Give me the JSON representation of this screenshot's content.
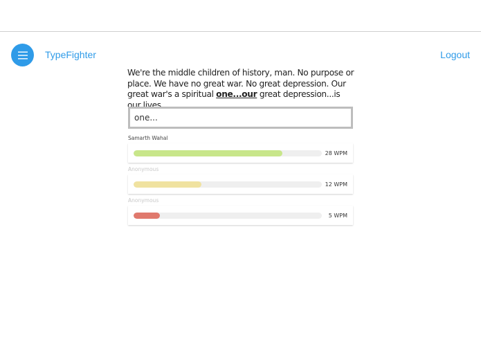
{
  "app": {
    "name": "TypeFighter",
    "logout_label": "Logout",
    "accent_color": "#2f9be8"
  },
  "menu": {
    "icon": "hamburger-menu-icon"
  },
  "quote": {
    "before": "We're the middle children of history, man. No purpose or place. We have no great war. No great depression. Our great war's a spiritual ",
    "current": "one...our",
    "after": " great depression...is our lives."
  },
  "typing_input": {
    "value": "one..."
  },
  "racers": [
    {
      "name": "Samarth Wahal",
      "wpm_label": "28 WPM",
      "progress": 0.79,
      "bar_color": "#c8e68a",
      "name_color": "#444444"
    },
    {
      "name": "Anonymous",
      "wpm_label": "12 WPM",
      "progress": 0.36,
      "bar_color": "#f0e2a0",
      "name_color": "#c8c8c8"
    },
    {
      "name": "Anonymous",
      "wpm_label": "5 WPM",
      "progress": 0.14,
      "bar_color": "#e0796d",
      "name_color": "#c8c8c8"
    }
  ]
}
